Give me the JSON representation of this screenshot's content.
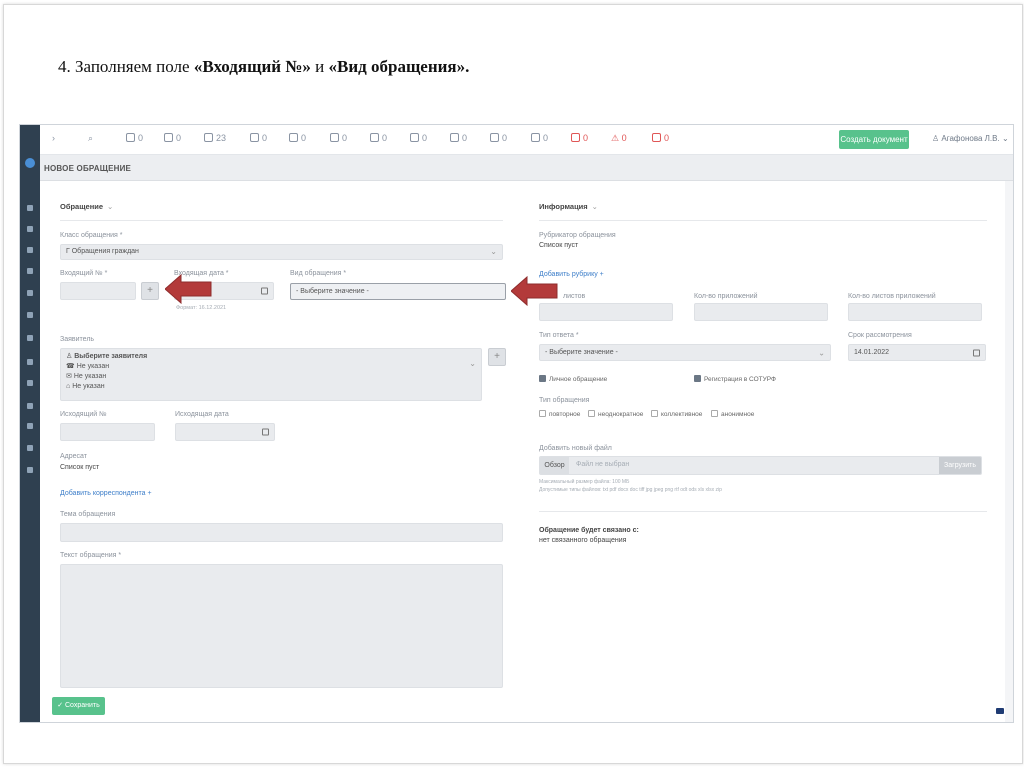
{
  "slide": {
    "step_prefix": "4. Заполняем поле ",
    "field_1": "«Входящий №»",
    "conjunction": " и ",
    "field_2": "«Вид обращения».",
    "accent_color": "#b33a3a"
  },
  "toolbar": {
    "items": [
      {
        "icon": "chevron-right-icon",
        "label": ">"
      },
      {
        "icon": "search-icon",
        "label": "Q"
      },
      {
        "icon": "incoming-icon",
        "label": "0"
      },
      {
        "icon": "outgoing-icon",
        "label": "0"
      },
      {
        "icon": "institution-icon",
        "label": "23"
      },
      {
        "icon": "document-icon",
        "label": "0"
      },
      {
        "icon": "edit-icon",
        "label": "0"
      },
      {
        "icon": "pen-icon",
        "label": "0"
      },
      {
        "icon": "checklist-icon",
        "label": "0"
      },
      {
        "icon": "message-icon",
        "label": "0"
      },
      {
        "icon": "user-check-icon",
        "label": "0"
      },
      {
        "icon": "network-icon",
        "label": "0"
      },
      {
        "icon": "copy-icon",
        "label": "0"
      },
      {
        "icon": "copy-red-icon",
        "label": "0"
      },
      {
        "icon": "warning-icon",
        "label": "0"
      },
      {
        "icon": "fire-icon",
        "label": "0"
      }
    ],
    "create_button": "Создать документ",
    "user": "Агафонова Л.В."
  },
  "page_title": "НОВОЕ ОБРАЩЕНИЕ",
  "left": {
    "section_title": "Обращение",
    "class_label": "Класс обращения *",
    "class_value": "Г Обращения граждан",
    "incoming_no_label": "Входящий № *",
    "incoming_no_value": "",
    "incoming_date_label": "Входящая дата *",
    "incoming_date_hint": "Формат: 16.12.2021",
    "appeal_type_label": "Вид обращения *",
    "appeal_type_value": "- Выберите значение -",
    "applicant_label": "Заявитель",
    "applicant_select": "Выберите заявителя",
    "applicant_phone": "Не указан",
    "applicant_email": "Не указан",
    "applicant_address": "Не указан",
    "outgoing_no_label": "Исходящий №",
    "outgoing_date_label": "Исходящая дата",
    "addressee_label": "Адресат",
    "addressee_value": "Список пуст",
    "add_correspondent": "Добавить корреспондента +",
    "subject_label": "Тема обращения",
    "text_label": "Текст обращения *",
    "save_button": "✓ Сохранить"
  },
  "right": {
    "section_title": "Информация",
    "rubricator_label": "Рубрикатор обращения",
    "rubricator_value": "Список пуст",
    "add_rubric": "Добавить рубрику +",
    "sheets_label": "листов",
    "attachments_label": "Кол-во приложений",
    "attachment_sheets_label": "Кол-во листов приложений",
    "response_type_label": "Тип ответа *",
    "response_type_value": "- Выберите значение -",
    "deadline_label": "Срок рассмотрения",
    "deadline_value": "14.01.2022",
    "personal_appeal": "Личное обращение",
    "sotur_registration": "Регистрация в СОТУРФ",
    "appeal_kind_label": "Тип обращения",
    "kinds": [
      "повторное",
      "неоднократное",
      "коллективное",
      "анонимное"
    ],
    "add_file_label": "Добавить новый файл",
    "browse_button": "Обзор",
    "no_file": "Файл не выбран",
    "upload_button": "Загрузить",
    "max_size_hint": "Максимальный размер файла: 100 МБ",
    "allowed_types_hint": "Допустимые типы файлов: txt pdf docx doc tiff jpg jpeg png rtf odt ods xls xlsx zip",
    "linked_title": "Обращение будет связано с:",
    "linked_value": "нет связанного обращения"
  }
}
